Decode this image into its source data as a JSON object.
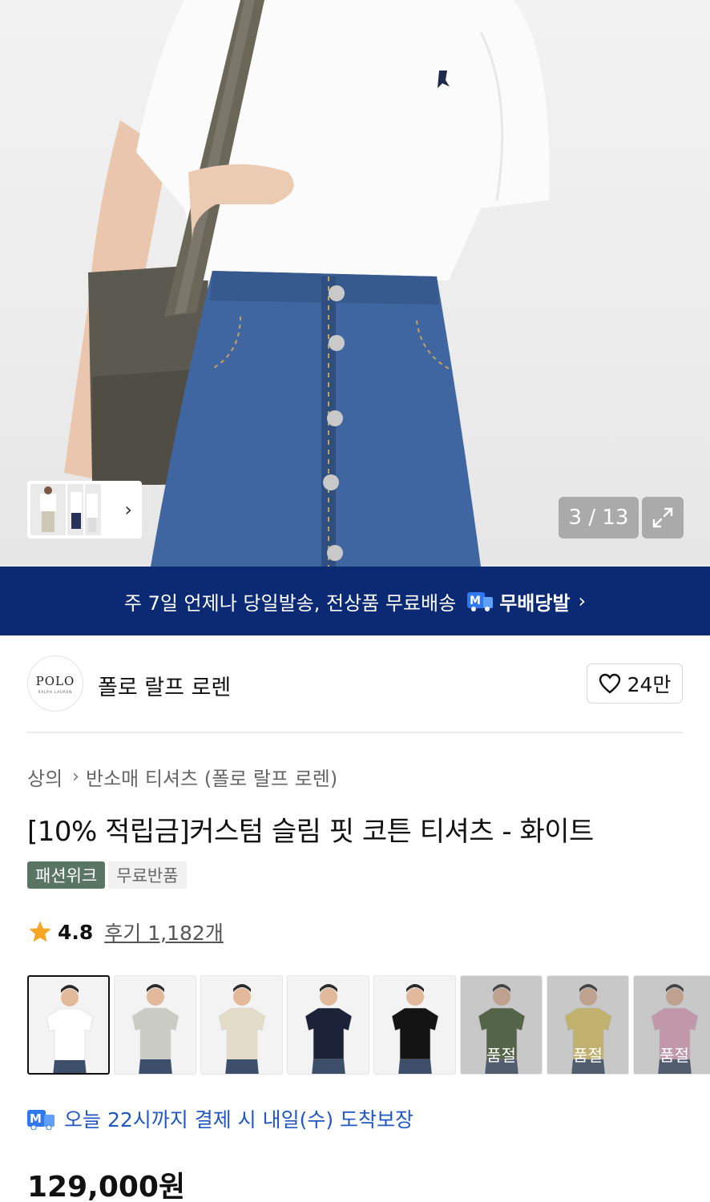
{
  "hero": {
    "counter": "3 / 13",
    "thumb_chevron": "›",
    "icons": {
      "expand": "expand-icon",
      "chevron": "chevron-right-icon"
    }
  },
  "banner": {
    "text": "주 7일 언제나 당일발송, 전상품 무료배송",
    "badge_letter": "M",
    "badge_label": "무배당발",
    "arrow": "›"
  },
  "brand": {
    "logo_text": "POLO",
    "logo_subtext": "RALPH LAUREN",
    "name": "폴로 랄프 로렌",
    "like_count": "24만"
  },
  "breadcrumb": {
    "category": "상의",
    "separator": "›",
    "subcategory": "반소매 티셔츠 (폴로 랄프 로렌)"
  },
  "product": {
    "title": "[10% 적립금]커스텀 슬림 핏 코튼 티셔츠 - 화이트",
    "tags": [
      "패션위크",
      "무료반품"
    ],
    "rating": "4.8",
    "review_label": "후기 1,182개",
    "price": "129,000원"
  },
  "colors": [
    {
      "name": "white",
      "shirt": "#ffffff",
      "soldout": false,
      "selected": true
    },
    {
      "name": "grey",
      "shirt": "#c9cbc4",
      "soldout": false,
      "selected": false
    },
    {
      "name": "beige",
      "shirt": "#e3dcc8",
      "soldout": false,
      "selected": false
    },
    {
      "name": "navy",
      "shirt": "#1c2238",
      "soldout": false,
      "selected": false
    },
    {
      "name": "black",
      "shirt": "#141414",
      "soldout": false,
      "selected": false
    },
    {
      "name": "green",
      "shirt": "#3f5a2e",
      "soldout": true,
      "selected": false
    },
    {
      "name": "yellow",
      "shirt": "#e9cf6a",
      "soldout": true,
      "selected": false
    },
    {
      "name": "pink",
      "shirt": "#e8a9c4",
      "soldout": true,
      "selected": false
    }
  ],
  "soldout_label": "품절",
  "delivery": {
    "text": "오늘 22시까지 결제 시 내일(수) 도착보장",
    "badge_letter": "M"
  },
  "theme": {
    "banner_bg": "#0b2a73",
    "tag_dark": "#5b7565",
    "delivery_blue": "#1f57c3",
    "star": "#f5a623"
  }
}
